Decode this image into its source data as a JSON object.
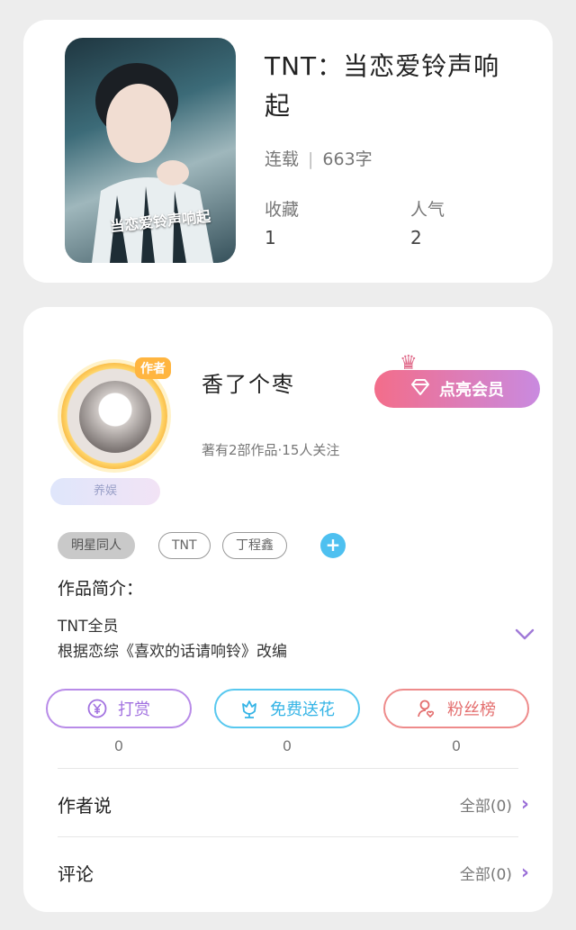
{
  "book": {
    "cover_title_text": "当恋爱铃声响起",
    "title": "TNT：当恋爱铃声响起",
    "status": "连载",
    "word_count": "663字",
    "favorites_label": "收藏",
    "favorites_value": "1",
    "popularity_label": "人气",
    "popularity_value": "2"
  },
  "author": {
    "badge": "作者",
    "fan_tag": "养娱",
    "name": "香了个枣",
    "stats": "著有2部作品·15人关注",
    "vip_button": "点亮会员"
  },
  "tags": [
    "明星同人",
    "TNT",
    "丁程鑫"
  ],
  "intro": {
    "label": "作品简介：",
    "line1": "TNT全员",
    "line2": "根据恋综《喜欢的话请响铃》改编"
  },
  "actions": [
    {
      "label": "打赏",
      "count": "0"
    },
    {
      "label": "免费送花",
      "count": "0"
    },
    {
      "label": "粉丝榜",
      "count": "0"
    }
  ],
  "rows": [
    {
      "label": "作者说",
      "right": "全部(0)"
    },
    {
      "label": "评论",
      "right": "全部(0)"
    }
  ],
  "colors": {
    "vip_start": "#f36d8a",
    "vip_end": "#c98ae0",
    "reward": "#a272e0",
    "flower": "#35b4e6",
    "fans": "#e46f6f",
    "add_tag": "#4ec0f0"
  },
  "icons": {
    "reward": "yen-coin-icon",
    "flower": "flower-icon",
    "fans": "user-heart-icon",
    "expand": "chevron-down-icon",
    "row_arrow": "chevron-right-icon",
    "vip": "diamond-icon"
  }
}
